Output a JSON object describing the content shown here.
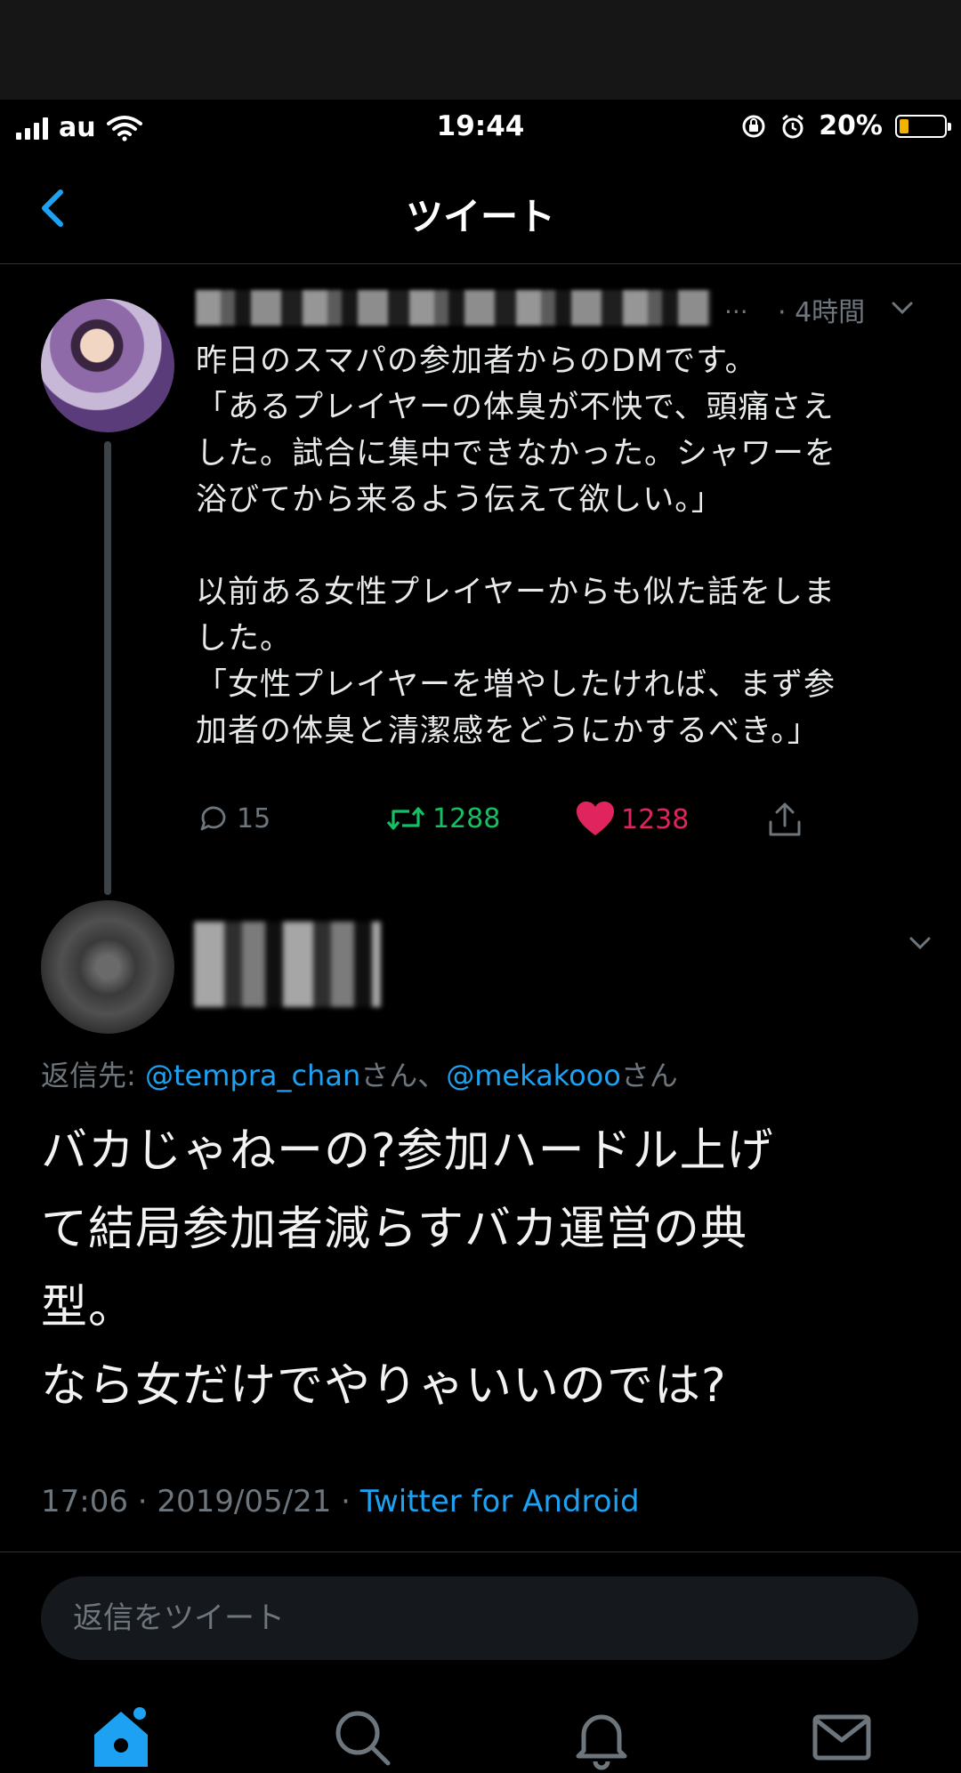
{
  "status_bar": {
    "carrier": "au",
    "time": "19:44",
    "battery": "20%",
    "battery_level": 0.2,
    "battery_color": "#f0b400"
  },
  "header": {
    "title": "ツイート",
    "back_icon": "chevron-left-icon"
  },
  "tweet_1": {
    "ellipsis": "...",
    "time": "· 4時間",
    "lines": [
      "昨日のスマパの参加者からのDMです。",
      "「あるプレイヤーの体臭が不快で、頭痛さえ",
      "した。試合に集中できなかった。シャワーを",
      "浴びてから来るよう伝えて欲しい。」",
      "以前ある女性プレイヤーからも似た話をしま",
      "した。",
      "「女性プレイヤーを増やしたければ、まず参",
      "加者の体臭と清潔感をどうにかするべき。」"
    ],
    "replies": "15",
    "retweets": "1288",
    "likes": "1238",
    "retweet_color": "#17bf63",
    "like_color": "#e0245e"
  },
  "tweet_2": {
    "reply_to_prefix": "返信先: ",
    "mention_1": "@tempra_chan",
    "mention_suffix_1": "さん、",
    "mention_2": "@mekakooo",
    "mention_suffix_2": "さん",
    "lines": [
      "バカじゃねーの?参加ハードル上げ",
      "て結局参加者減らすバカ運営の典",
      "型。",
      "なら女だけでやりゃいいのでは?"
    ],
    "timestamp": "17:06 · 2019/05/21 · ",
    "source": "Twitter for Android",
    "link_color": "#1da1f2"
  },
  "reply_box": {
    "placeholder": "返信をツイート"
  },
  "tabs": [
    "home-icon",
    "search-icon",
    "notifications-icon",
    "messages-icon"
  ]
}
